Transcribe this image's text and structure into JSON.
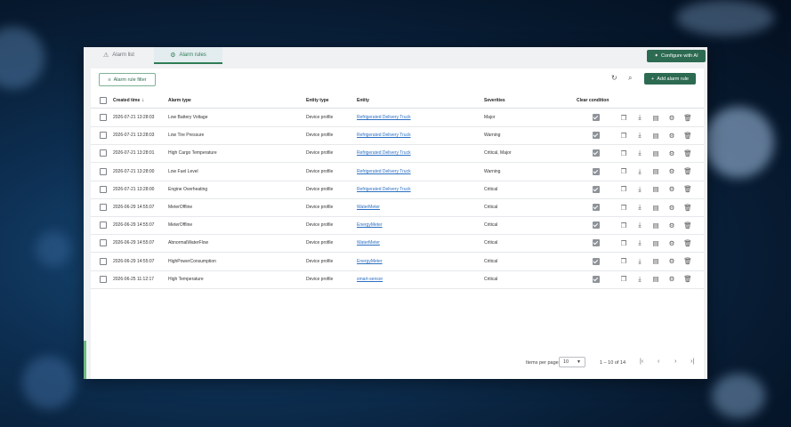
{
  "tabs": [
    {
      "label": "Alarm list",
      "icon": "warning-icon"
    },
    {
      "label": "Alarm rules",
      "icon": "rules-icon"
    }
  ],
  "header": {
    "configure_ai_label": "Configure with AI"
  },
  "toolbar": {
    "filter_label": "Alarm rule filter",
    "add_label": "Add alarm rule"
  },
  "table": {
    "columns": [
      "Created time",
      "Alarm type",
      "Entity type",
      "Entity",
      "Severities",
      "Clear condition"
    ],
    "sort_column": "Created time",
    "rows": [
      {
        "created": "2026-07-21 13:28:03",
        "alarm_type": "Low Battery Voltage",
        "entity_type": "Device profile",
        "entity": "Refrigerated Delivery Truck",
        "severities": "Major",
        "clear": true
      },
      {
        "created": "2026-07-21 13:28:03",
        "alarm_type": "Low Tire Pressure",
        "entity_type": "Device profile",
        "entity": "Refrigerated Delivery Truck",
        "severities": "Warning",
        "clear": true
      },
      {
        "created": "2026-07-21 13:28:01",
        "alarm_type": "High Cargo Temperature",
        "entity_type": "Device profile",
        "entity": "Refrigerated Delivery Truck",
        "severities": "Critical, Major",
        "clear": true
      },
      {
        "created": "2026-07-21 13:28:00",
        "alarm_type": "Low Fuel Level",
        "entity_type": "Device profile",
        "entity": "Refrigerated Delivery Truck",
        "severities": "Warning",
        "clear": true
      },
      {
        "created": "2026-07-21 13:28:00",
        "alarm_type": "Engine Overheating",
        "entity_type": "Device profile",
        "entity": "Refrigerated Delivery Truck",
        "severities": "Critical",
        "clear": true
      },
      {
        "created": "2026-06-29 14:55:07",
        "alarm_type": "MeterOffline",
        "entity_type": "Device profile",
        "entity": "WaterMeter",
        "severities": "Critical",
        "clear": true
      },
      {
        "created": "2026-06-29 14:55:07",
        "alarm_type": "MeterOffline",
        "entity_type": "Device profile",
        "entity": "EnergyMeter",
        "severities": "Critical",
        "clear": true
      },
      {
        "created": "2026-06-29 14:55:07",
        "alarm_type": "AbnormalWaterFlow",
        "entity_type": "Device profile",
        "entity": "WaterMeter",
        "severities": "Critical",
        "clear": true
      },
      {
        "created": "2026-06-29 14:55:07",
        "alarm_type": "HighPowerConsumption",
        "entity_type": "Device profile",
        "entity": "EnergyMeter",
        "severities": "Critical",
        "clear": true
      },
      {
        "created": "2026-06-25 11:12:17",
        "alarm_type": "High Temperature",
        "entity_type": "Device profile",
        "entity": "smart-sensor",
        "severities": "Critical",
        "clear": true
      }
    ]
  },
  "pagination": {
    "items_per_page_label": "Items per page",
    "page_size": "10",
    "range": "1 – 10 of 14"
  }
}
